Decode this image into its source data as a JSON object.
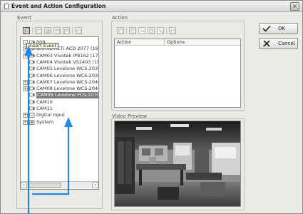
{
  "window": {
    "title": "Event and Action Configuration",
    "close_glyph": "×"
  },
  "event_panel": {
    "label": "Event",
    "tooltip": "Insert Event",
    "tree": [
      {
        "label": "009",
        "icon": "camera-icon",
        "expander": "-"
      },
      {
        "label": "CAM02 ACTi ACD 2077 (192.168",
        "icon": "camera-icon",
        "expander": "+"
      },
      {
        "label": "CAM03 Vivotek IP8162 (17",
        "icon": "camera-icon",
        "expander": "+"
      },
      {
        "label": "CAM04 Vivotek VS2403 (19",
        "icon": "camera-icon",
        "expander": ""
      },
      {
        "label": "CAM05 Levelone WCS-2030",
        "icon": "camera-icon",
        "expander": ""
      },
      {
        "label": "CAM06 Levelone WCS-2030",
        "icon": "camera-icon",
        "expander": ""
      },
      {
        "label": "CAM07 Levelone WCS-2040",
        "icon": "camera-icon",
        "expander": "+"
      },
      {
        "label": "CAM08 Levelone WCS-2040",
        "icon": "camera-icon",
        "expander": "+"
      },
      {
        "label": "CAM09 Levelone FCS-1070",
        "icon": "camera-icon",
        "expander": "",
        "selected": true
      },
      {
        "label": "CAM10",
        "icon": "camera-icon",
        "expander": ""
      },
      {
        "label": "CAM11",
        "icon": "camera-icon",
        "expander": ""
      },
      {
        "label": "Digital Input",
        "icon": "digital-input-icon",
        "expander": "+"
      },
      {
        "label": "System",
        "icon": "system-icon",
        "expander": "+"
      }
    ]
  },
  "action_panel": {
    "label": "Action",
    "columns": [
      "Action",
      "Options"
    ]
  },
  "video_preview": {
    "label": "Video Preview"
  },
  "buttons": {
    "ok": "OK",
    "cancel": "Cancel"
  },
  "colors": {
    "annotation_arrow": "#1e88e5",
    "ok_check": "#222222",
    "cancel_x": "#222222"
  }
}
